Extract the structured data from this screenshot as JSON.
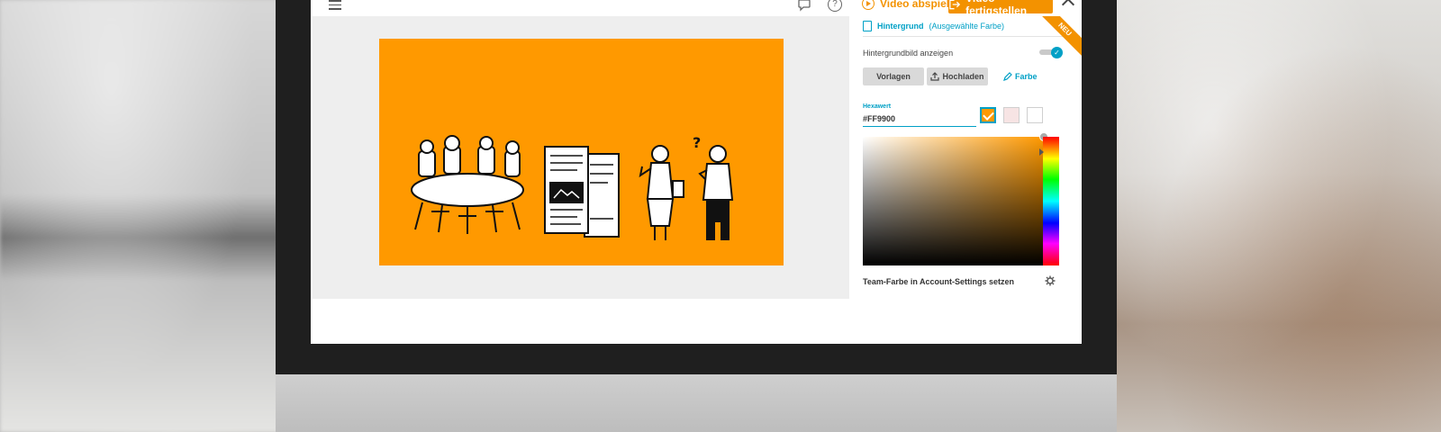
{
  "toolbar": {
    "play_label": "Video abspielen",
    "finish_label": "Video fertigstellen"
  },
  "panel": {
    "header_title": "Hintergrund",
    "header_sub": "(Ausgewählte Farbe)",
    "badge": "NEU",
    "show_bg_label": "Hintergrundbild anzeigen",
    "show_bg_on": true,
    "tabs": {
      "templates": "Vorlagen",
      "upload": "Hochladen",
      "color": "Farbe"
    },
    "hex_label": "Hexawert",
    "hex_value": "#FF9900",
    "swatches": [
      "#ff9900",
      "#f7e4e4",
      "#ffffff"
    ],
    "team_color_label": "Team-Farbe in Account-Settings setzen"
  },
  "canvas": {
    "background": "#ff9900"
  },
  "colors": {
    "accent": "#f39200",
    "link": "#00a0c6"
  },
  "icons": [
    "menu-icon",
    "chat-icon",
    "help-icon",
    "play-icon",
    "export-icon",
    "chevron-up-icon",
    "file-icon",
    "upload-icon",
    "pipette-icon",
    "check-icon",
    "gear-icon"
  ]
}
